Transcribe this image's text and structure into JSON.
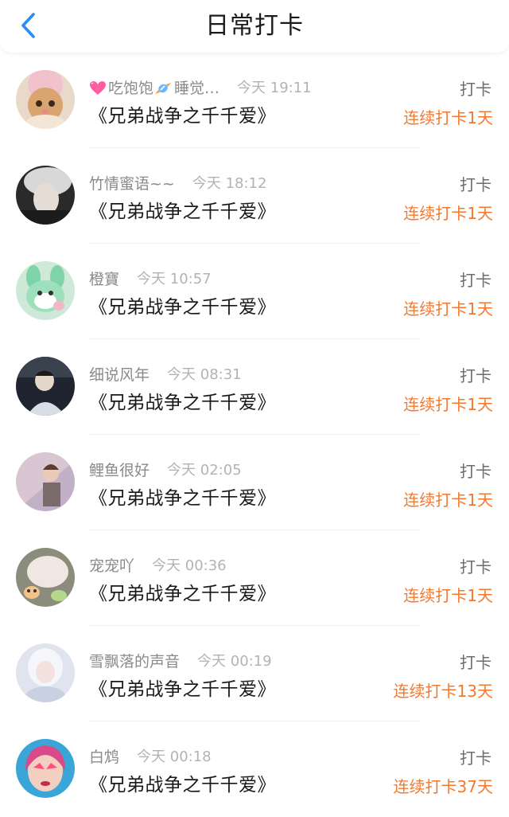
{
  "header": {
    "title": "日常打卡",
    "back_icon": "chevron-left-icon",
    "accent_color": "#2b8cf2"
  },
  "colors": {
    "streak": "#f3782d",
    "name": "#8a8a8a",
    "time": "#b3b3b3"
  },
  "entries": [
    {
      "name_parts": [
        "吃饱饱",
        "睡觉…"
      ],
      "emoji": [
        "heart-icon",
        "candy-icon"
      ],
      "time": "今天 19:11",
      "book": "《兄弟战争之千千爱》",
      "action": "打卡",
      "streak": "连续打卡1天"
    },
    {
      "name": "竹情蜜语~~",
      "time": "今天 18:12",
      "book": "《兄弟战争之千千爱》",
      "action": "打卡",
      "streak": "连续打卡1天"
    },
    {
      "name": "橙寶",
      "time": "今天 10:57",
      "book": "《兄弟战争之千千爱》",
      "action": "打卡",
      "streak": "连续打卡1天"
    },
    {
      "name": "细说风年",
      "time": "今天 08:31",
      "book": "《兄弟战争之千千爱》",
      "action": "打卡",
      "streak": "连续打卡1天"
    },
    {
      "name": "鲤鱼很好",
      "time": "今天 02:05",
      "book": "《兄弟战争之千千爱》",
      "action": "打卡",
      "streak": "连续打卡1天"
    },
    {
      "name": "宠宠吖",
      "time": "今天 00:36",
      "book": "《兄弟战争之千千爱》",
      "action": "打卡",
      "streak": "连续打卡1天"
    },
    {
      "name": "雪飘落的声音",
      "time": "今天 00:19",
      "book": "《兄弟战争之千千爱》",
      "action": "打卡",
      "streak": "连续打卡13天"
    },
    {
      "name": "白鸩",
      "time": "今天 00:18",
      "book": "《兄弟战争之千千爱》",
      "action": "打卡",
      "streak": "连续打卡37天"
    }
  ]
}
